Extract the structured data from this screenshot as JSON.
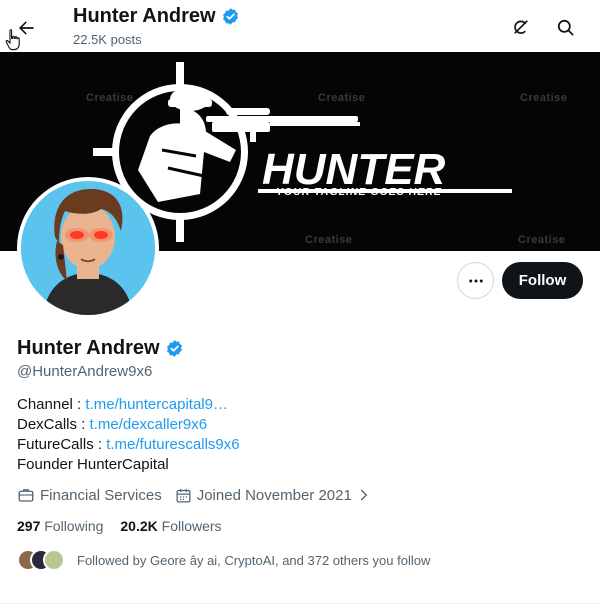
{
  "header": {
    "name": "Hunter Andrew",
    "posts_count": "22.5K posts"
  },
  "banner": {
    "title": "HUNTER",
    "tagline": "YOUR TAGLINE GOES HERE",
    "watermark": "Creatise"
  },
  "actions": {
    "follow_label": "Follow"
  },
  "profile": {
    "name": "Hunter Andrew",
    "handle": "@HunterAndrew9x6",
    "bio": {
      "line1_label": "Channel : ",
      "line1_link": "t.me/huntercapital9…",
      "line2_label": "DexCalls : ",
      "line2_link": "t.me/dexcaller9x6",
      "line3_label": "FutureCalls : ",
      "line3_link": "t.me/futurescalls9x6",
      "line4": "Founder HunterCapital"
    },
    "category": "Financial Services",
    "joined": "Joined November 2021",
    "following_count": "297",
    "following_label": "Following",
    "followers_count": "20.2K",
    "followers_label": "Followers",
    "followed_by": "Followed by Geore ây ai, CryptoAI, and 372 others you follow"
  },
  "colors": {
    "accent": "#1d9bf0",
    "text": "#0f1419",
    "muted": "#536471",
    "button_dark": "#0f1419"
  },
  "icons": {
    "back": "arrow-left-icon",
    "verified": "verified-badge-icon",
    "grok": "grok-icon",
    "search": "search-icon",
    "more": "more-dots-icon",
    "category": "briefcase-icon",
    "joined": "calendar-icon",
    "chevron": "chevron-right-icon"
  }
}
